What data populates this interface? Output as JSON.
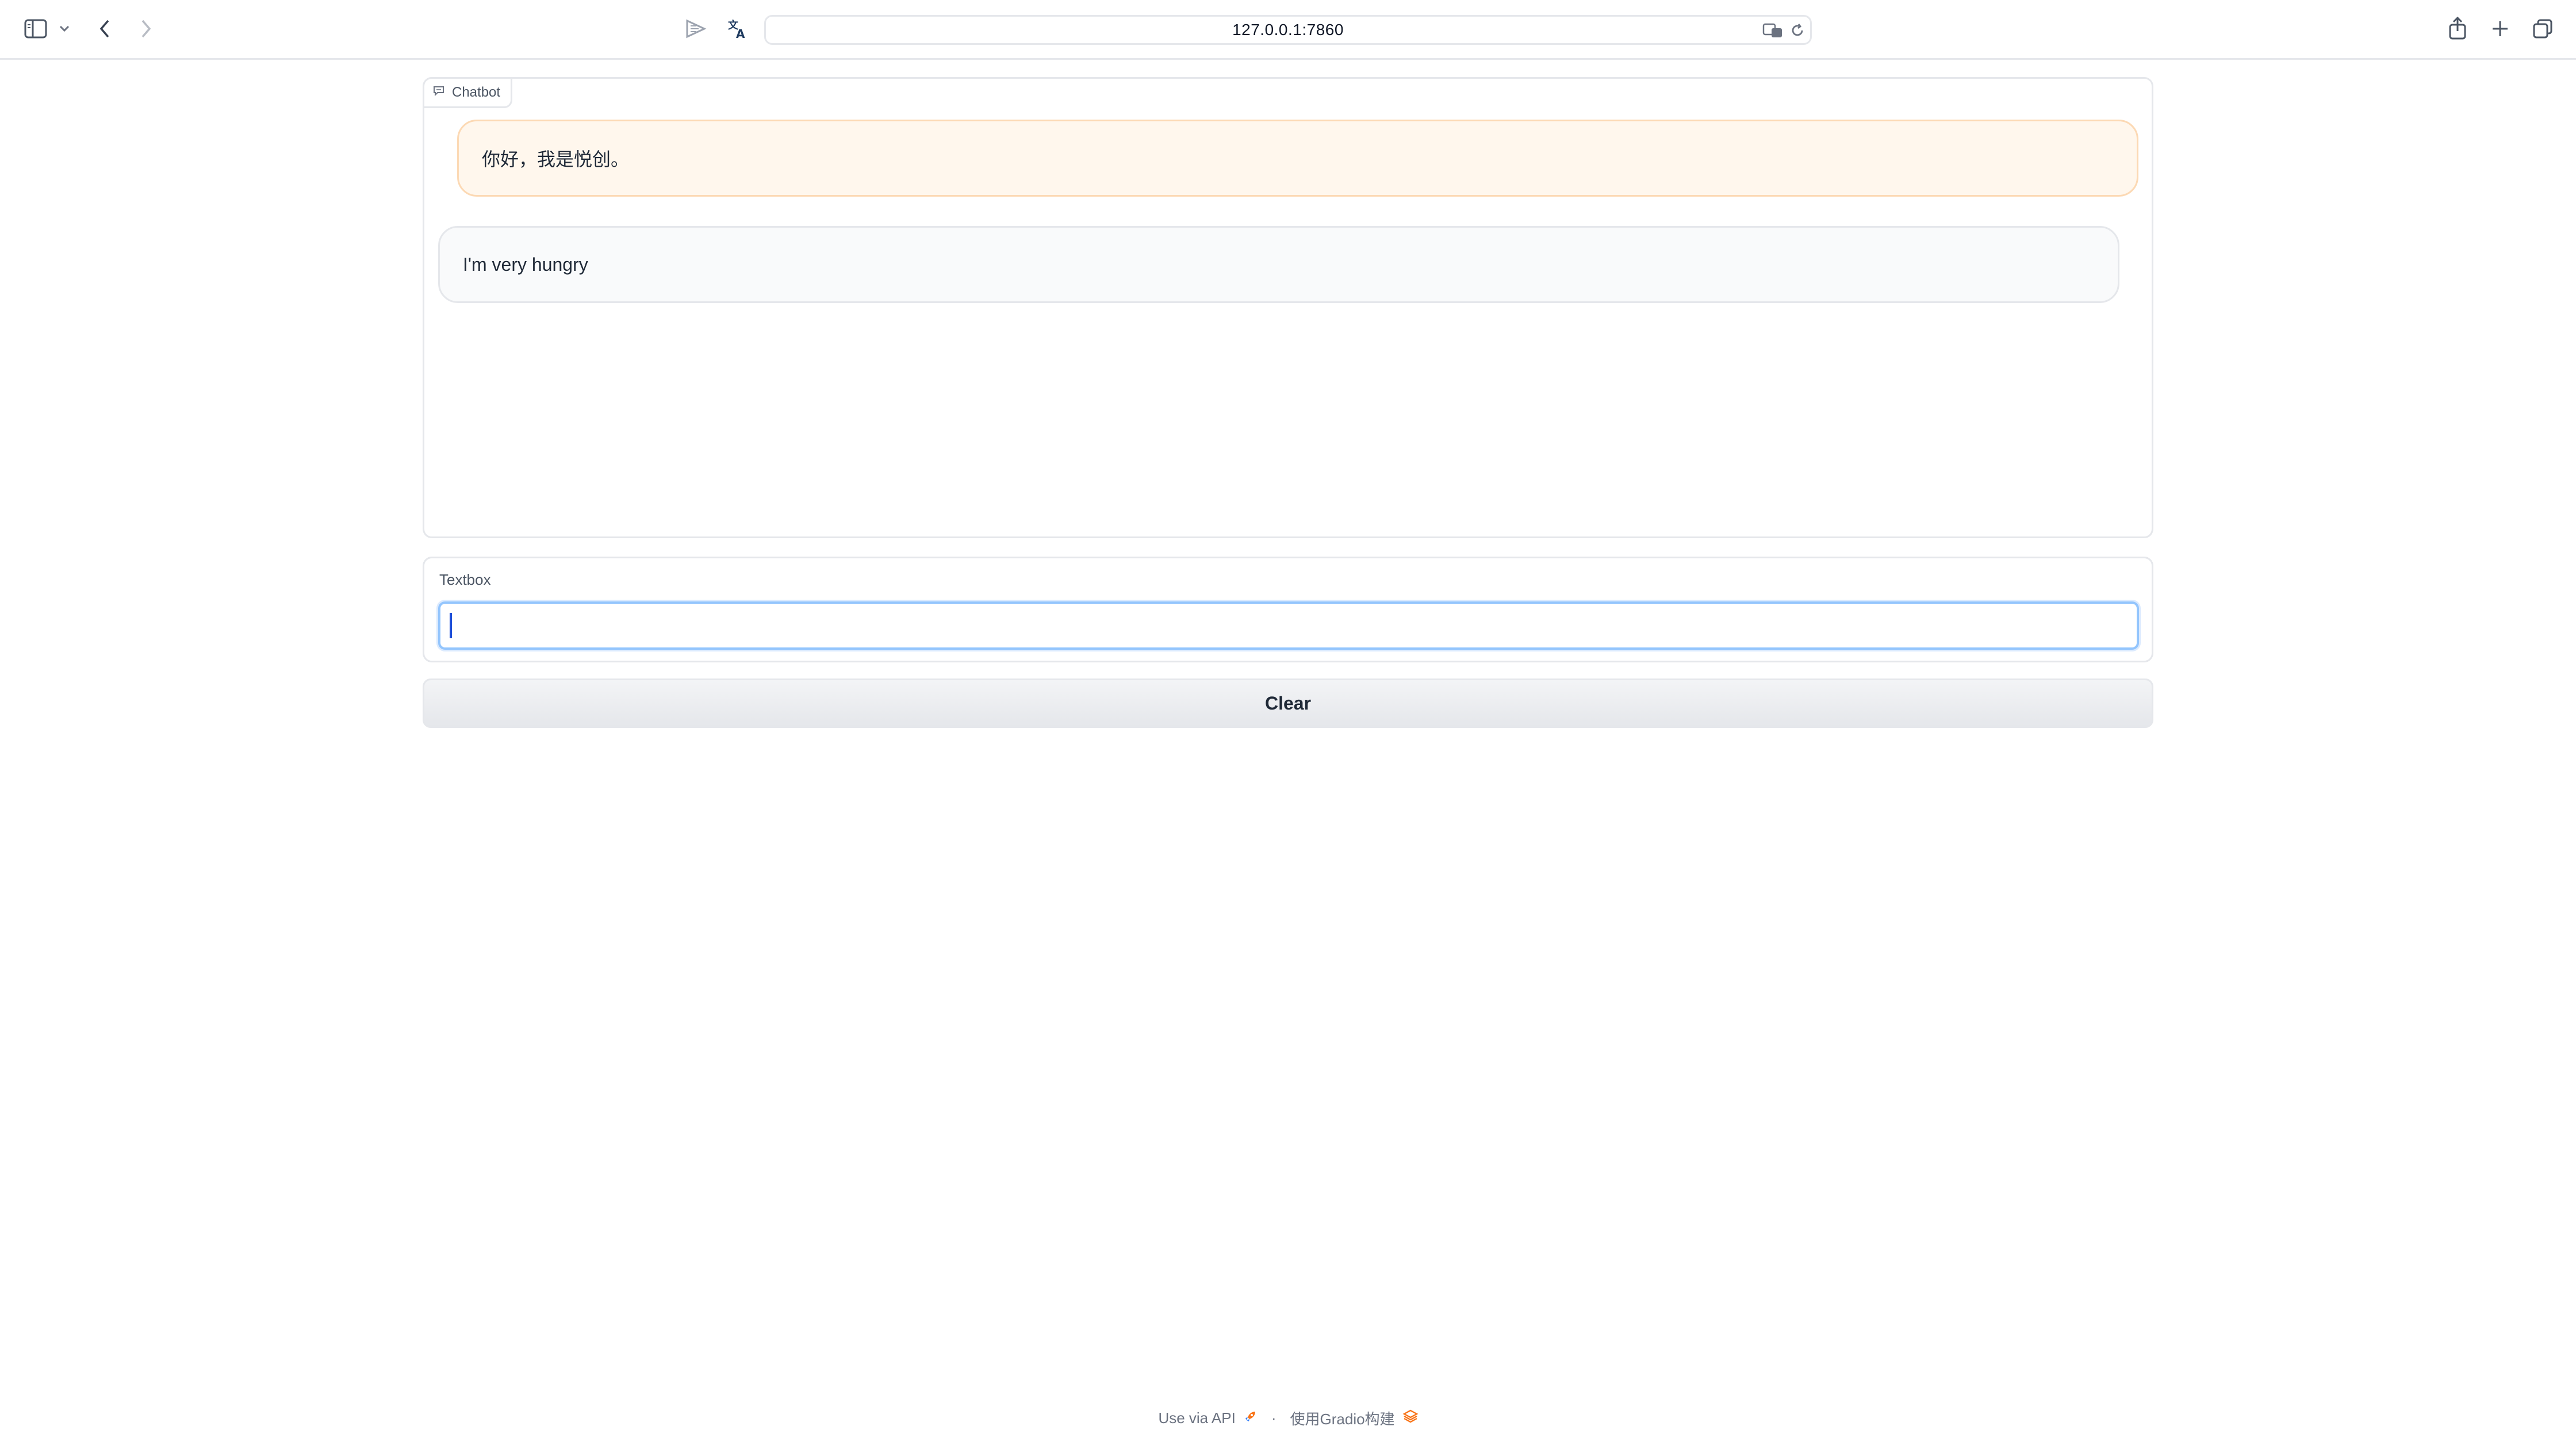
{
  "browser": {
    "url": "127.0.0.1:7860"
  },
  "chatbot": {
    "label": "Chatbot",
    "messages": [
      {
        "role": "user",
        "text": "你好，我是悦创。"
      },
      {
        "role": "bot",
        "text": "I'm very hungry"
      }
    ]
  },
  "textbox": {
    "label": "Textbox",
    "value": ""
  },
  "clear_button": {
    "label": "Clear"
  },
  "footer": {
    "api_link": "Use via API",
    "separator": "·",
    "built_with": "使用Gradio构建"
  },
  "colors": {
    "accent": "#f97316",
    "user_bubble": "#fff7ed",
    "bot_bubble": "#f9fafb",
    "focus_border": "#93c5fd"
  }
}
